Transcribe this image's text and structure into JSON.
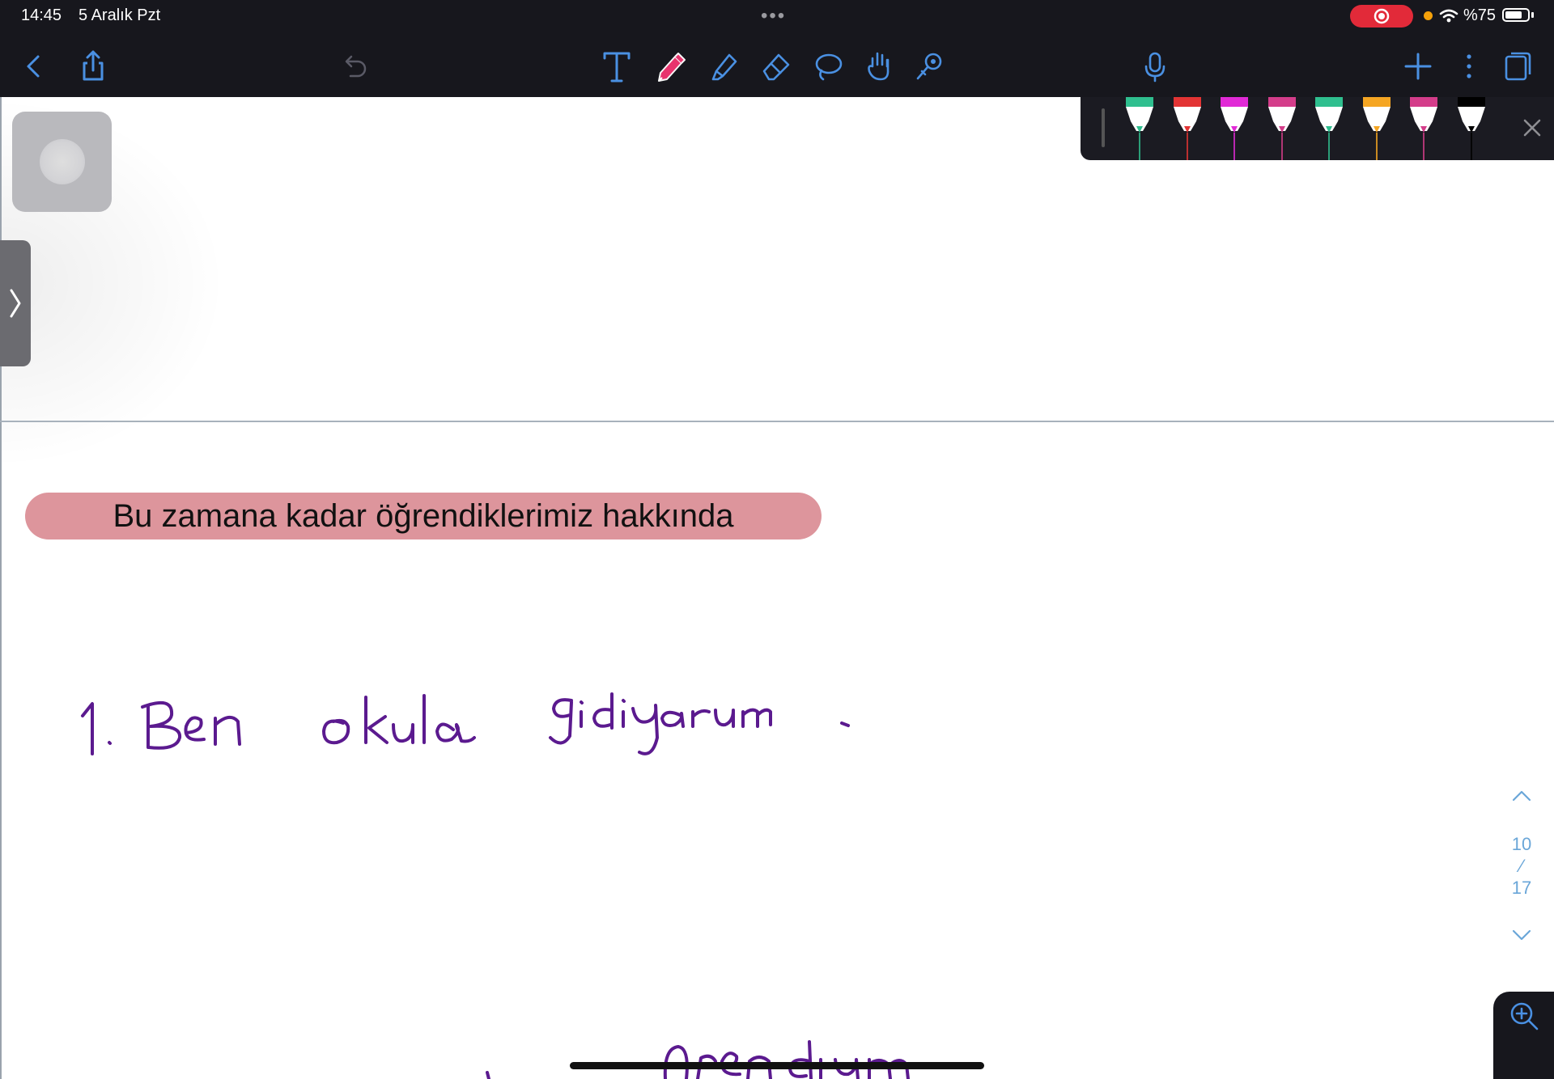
{
  "status_bar": {
    "time": "14:45",
    "date": "5 Aralık Pzt",
    "multitask_dots": "•••",
    "battery_text": "%75",
    "battery_level": 0.75,
    "recording_color": "#e22a39"
  },
  "toolbar": {
    "icons": [
      "back-icon",
      "share-icon",
      "undo-icon",
      "text-tool-icon",
      "pen-tool-icon",
      "highlighter-tool-icon",
      "eraser-tool-icon",
      "lasso-tool-icon",
      "hand-tool-icon",
      "laser-pointer-icon",
      "microphone-icon",
      "add-icon",
      "more-icon",
      "pages-icon"
    ],
    "active_tool": "pen-tool-icon",
    "accent": "#4a90e2"
  },
  "pen_palette": {
    "colors": [
      "#2fbf8f",
      "#e33434",
      "#e12ad6",
      "#d43d8a",
      "#2fbf8f",
      "#f5a623",
      "#d43d8a",
      "#000000"
    ]
  },
  "note": {
    "heading": "Bu zamana kadar öğrendiklerimiz hakkında",
    "heading_color": "#dd959c",
    "ink_color": "#5b1a8f"
  },
  "page_nav": {
    "current": "10",
    "separator": "⁄",
    "total": "17"
  }
}
